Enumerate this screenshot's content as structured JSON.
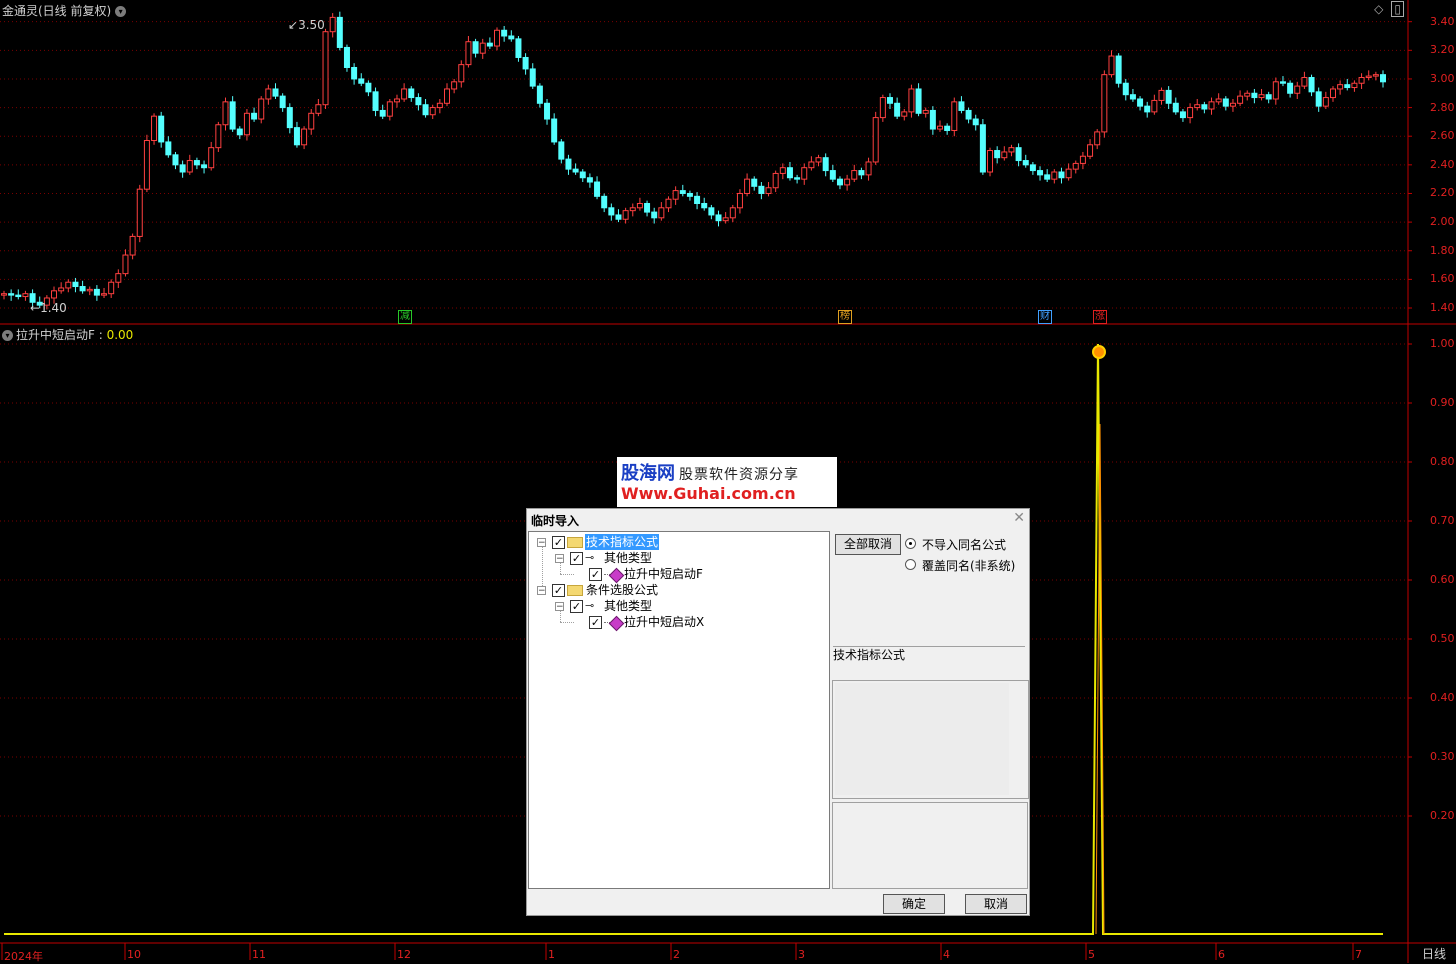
{
  "header": {
    "title": "金通灵(日线 前复权)",
    "indicator_name": "拉升中短启动F",
    "indicator_sep": " : ",
    "indicator_value": "0.00",
    "period": "日线"
  },
  "price_axis": {
    "ticks": [
      "3.40",
      "3.20",
      "3.00",
      "2.80",
      "2.60",
      "2.40",
      "2.20",
      "2.00",
      "1.80",
      "1.60",
      "1.40"
    ],
    "high_label": "3.50",
    "low_label": "1.40"
  },
  "indicator_axis": {
    "ticks": [
      "1.00",
      "0.90",
      "0.80",
      "0.70",
      "0.60",
      "0.50",
      "0.40",
      "0.30",
      "0.20"
    ]
  },
  "date_axis": {
    "labels": [
      "2024年",
      "10",
      "11",
      "12",
      "1",
      "2",
      "3",
      "4",
      "5",
      "6",
      "7"
    ]
  },
  "markers": [
    {
      "text": "减",
      "color": "#28c828"
    },
    {
      "text": "榜",
      "color": "#e0a020"
    },
    {
      "text": "财",
      "color": "#40a0ff"
    },
    {
      "text": "涨",
      "color": "#e02020"
    }
  ],
  "colors": {
    "up": "#ff4040",
    "down": "#54ffff",
    "indicator_line": "#e8e800",
    "axis": "#c00000"
  },
  "chart_data": [
    {
      "type": "candlestick",
      "title": "金通灵(日线 前复权)",
      "ylim": [
        1.3,
        3.5
      ],
      "annotations": [
        {
          "label": "3.50",
          "kind": "high"
        },
        {
          "label": "1.40",
          "kind": "low"
        }
      ],
      "closes": [
        1.5,
        1.49,
        1.48,
        1.5,
        1.44,
        1.42,
        1.47,
        1.52,
        1.54,
        1.58,
        1.55,
        1.52,
        1.53,
        1.49,
        1.5,
        1.58,
        1.64,
        1.77,
        1.9,
        2.23,
        2.57,
        2.74,
        2.56,
        2.47,
        2.4,
        2.35,
        2.43,
        2.4,
        2.38,
        2.52,
        2.68,
        2.84,
        2.65,
        2.61,
        2.76,
        2.72,
        2.86,
        2.93,
        2.88,
        2.8,
        2.66,
        2.54,
        2.65,
        2.76,
        2.82,
        3.33,
        3.43,
        3.22,
        3.08,
        3.0,
        2.97,
        2.91,
        2.78,
        2.74,
        2.84,
        2.86,
        2.93,
        2.87,
        2.82,
        2.75,
        2.8,
        2.83,
        2.93,
        2.98,
        3.1,
        3.26,
        3.18,
        3.25,
        3.23,
        3.34,
        3.3,
        3.28,
        3.15,
        3.07,
        2.95,
        2.83,
        2.72,
        2.56,
        2.44,
        2.37,
        2.35,
        2.31,
        2.28,
        2.18,
        2.1,
        2.05,
        2.02,
        2.08,
        2.1,
        2.13,
        2.07,
        2.03,
        2.1,
        2.16,
        2.22,
        2.2,
        2.18,
        2.13,
        2.1,
        2.05,
        2.01,
        2.03,
        2.1,
        2.2,
        2.3,
        2.25,
        2.2,
        2.24,
        2.34,
        2.38,
        2.31,
        2.3,
        2.38,
        2.42,
        2.45,
        2.36,
        2.3,
        2.26,
        2.3,
        2.36,
        2.33,
        2.42,
        2.73,
        2.87,
        2.83,
        2.74,
        2.77,
        2.93,
        2.76,
        2.78,
        2.65,
        2.67,
        2.64,
        2.84,
        2.78,
        2.72,
        2.68,
        2.35,
        2.5,
        2.45,
        2.49,
        2.52,
        2.43,
        2.4,
        2.36,
        2.33,
        2.3,
        2.35,
        2.31,
        2.37,
        2.41,
        2.46,
        2.54,
        2.63,
        3.03,
        3.16,
        2.97,
        2.89,
        2.86,
        2.81,
        2.77,
        2.85,
        2.92,
        2.83,
        2.77,
        2.73,
        2.8,
        2.82,
        2.79,
        2.84,
        2.86,
        2.81,
        2.83,
        2.88,
        2.9,
        2.87,
        2.89,
        2.86,
        2.98,
        2.97,
        2.9,
        2.95,
        3.01,
        2.91,
        2.81,
        2.87,
        2.93,
        2.96,
        2.94,
        2.97,
        3.01,
        3.02,
        3.03,
        2.98
      ]
    },
    {
      "type": "line",
      "title": "拉升中短启动F",
      "ylim": [
        0.0,
        1.0
      ],
      "baseline": 0.0,
      "peak": 1.0
    }
  ],
  "dialog": {
    "title": "临时导入",
    "tree": [
      {
        "label": "技术指标公式",
        "level": 0,
        "icon": "folder-icon",
        "checked": true,
        "selected": true
      },
      {
        "label": "其他类型",
        "level": 1,
        "icon": "key-icon",
        "checked": true
      },
      {
        "label": "拉升中短启动F",
        "level": 2,
        "icon": "formula-icon",
        "checked": true
      },
      {
        "label": "条件选股公式",
        "level": 0,
        "icon": "folder-icon",
        "checked": true
      },
      {
        "label": "其他类型",
        "level": 1,
        "icon": "key-icon",
        "checked": true
      },
      {
        "label": "拉升中短启动X",
        "level": 2,
        "icon": "formula-icon",
        "checked": true
      }
    ],
    "deselect_all_label": "全部取消",
    "radio_no_import": "不导入同名公式",
    "radio_overwrite": "覆盖同名(非系统)",
    "section_label": "技术指标公式",
    "ok_label": "确定",
    "cancel_label": "取消"
  },
  "watermark": {
    "brand": "股海网",
    "tagline": "股票软件资源分享",
    "url": "Www.Guhai.com.cn"
  }
}
